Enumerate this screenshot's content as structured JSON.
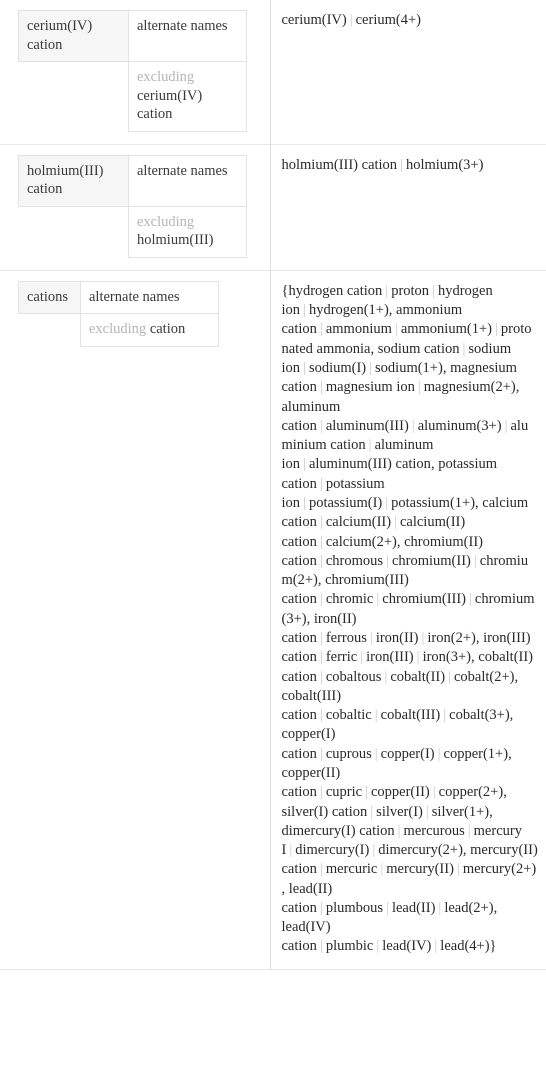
{
  "rows": [
    {
      "id": "cerium-iv-cation",
      "layout": "wide",
      "entity_label": "cerium(IV) cation",
      "property_label": "alternate names",
      "exclusion_prefix": "excluding",
      "exclusion_term": "cerium(IV) cation",
      "alternate_names": [
        "cerium(IV)",
        "cerium(4+)"
      ],
      "wrapped": false
    },
    {
      "id": "holmium-iii-cation",
      "layout": "wide",
      "entity_label": "holmium(III) cation",
      "property_label": "alternate names",
      "exclusion_prefix": "excluding",
      "exclusion_term": "holmium(III)",
      "alternate_names": [
        "holmium(III) cation",
        "holmium(3+)"
      ],
      "wrapped": false
    },
    {
      "id": "cations",
      "layout": "narrow",
      "entity_label": "cations",
      "property_label": "alternate names",
      "exclusion_prefix": "excluding",
      "exclusion_term": "cation",
      "wrapped": true,
      "open_brace": "{",
      "close_brace": "}",
      "groups": [
        [
          "hydrogen cation",
          "proton",
          "hydrogen ion",
          "hydrogen(1+)"
        ],
        [
          "ammonium cation",
          "ammonium",
          "ammonium(1+)",
          "protonated ammonia"
        ],
        [
          "sodium cation",
          "sodium ion",
          "sodium(I)",
          "sodium(1+)"
        ],
        [
          "magnesium cation",
          "magnesium ion",
          "magnesium(2+)"
        ],
        [
          "aluminum cation",
          "aluminum(III)",
          "aluminum(3+)",
          "aluminium cation",
          "aluminum ion",
          "aluminum(III) cation"
        ],
        [
          "potassium cation",
          "potassium ion",
          "potassium(I)",
          "potassium(1+)"
        ],
        [
          "calcium cation",
          "calcium(II)",
          "calcium(II) cation",
          "calcium(2+)"
        ],
        [
          "chromium(II) cation",
          "chromous",
          "chromium(II)",
          "chromium(2+)"
        ],
        [
          "chromium(III) cation",
          "chromic",
          "chromium(III)",
          "chromium(3+)"
        ],
        [
          "iron(II) cation",
          "ferrous",
          "iron(II)",
          "iron(2+)"
        ],
        [
          "iron(III) cation",
          "ferric",
          "iron(III)",
          "iron(3+)"
        ],
        [
          "cobalt(II) cation",
          "cobaltous",
          "cobalt(II)",
          "cobalt(2+)"
        ],
        [
          "cobalt(III) cation",
          "cobaltic",
          "cobalt(III)",
          "cobalt(3+)"
        ],
        [
          "copper(I) cation",
          "cuprous",
          "copper(I)",
          "copper(1+)"
        ],
        [
          "copper(II) cation",
          "cupric",
          "copper(II)",
          "copper(2+)"
        ],
        [
          "silver(I) cation",
          "silver(I)",
          "silver(1+)"
        ],
        [
          "dimercury(I) cation",
          "mercurous",
          "mercury I",
          "dimercury(I)",
          "dimercury(2+)"
        ],
        [
          "mercury(II) cation",
          "mercuric",
          "mercury(II)",
          "mercury(2+)"
        ],
        [
          "lead(II) cation",
          "plumbous",
          "lead(II)",
          "lead(2+)"
        ],
        [
          "lead(IV) cation",
          "plumbic",
          "lead(IV)",
          "lead(4+)"
        ]
      ]
    }
  ],
  "colors": {
    "text": "#2a2a2a",
    "muted": "#b5b5b5",
    "separator": "#c9c9c9",
    "header_cell_bg": "#f6f6f6",
    "grid_line": "#e2e2e2",
    "row_divider": "#e8e8e8"
  }
}
